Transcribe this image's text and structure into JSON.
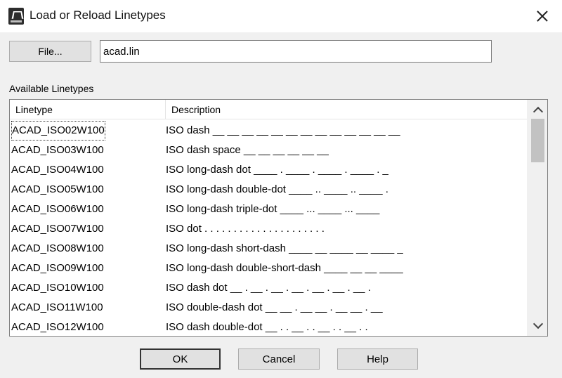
{
  "window": {
    "title": "Load or Reload Linetypes",
    "app_icon": "autocad-app-icon",
    "close_icon": "close-icon"
  },
  "file": {
    "button_label": "File...",
    "filename": "acad.lin"
  },
  "section_label": "Available Linetypes",
  "columns": {
    "linetype": "Linetype",
    "description": "Description"
  },
  "rows": [
    {
      "name": "ACAD_ISO02W100",
      "description": "ISO dash __ __ __ __ __ __ __ __ __ __ __ __ __"
    },
    {
      "name": "ACAD_ISO03W100",
      "description": "ISO dash space __    __    __    __    __    __"
    },
    {
      "name": "ACAD_ISO04W100",
      "description": "ISO long-dash dot ____ . ____ . ____ . ____ . _"
    },
    {
      "name": "ACAD_ISO05W100",
      "description": "ISO long-dash double-dot ____ .. ____ .. ____ ."
    },
    {
      "name": "ACAD_ISO06W100",
      "description": "ISO long-dash triple-dot ____ ... ____ ... ____"
    },
    {
      "name": "ACAD_ISO07W100",
      "description": "ISO dot . . . . . . . . . . . . . . . . . . . . ."
    },
    {
      "name": "ACAD_ISO08W100",
      "description": "ISO long-dash short-dash ____ __ ____ __ ____ _"
    },
    {
      "name": "ACAD_ISO09W100",
      "description": "ISO long-dash double-short-dash ____ __ __ ____"
    },
    {
      "name": "ACAD_ISO10W100",
      "description": "ISO dash dot __ . __ . __ . __ . __ . __ . __ ."
    },
    {
      "name": "ACAD_ISO11W100",
      "description": "ISO double-dash dot __ __ . __ __ . __ __ . __"
    },
    {
      "name": "ACAD_ISO12W100",
      "description": "ISO dash double-dot __ . . __ . . __ . . __ . ."
    }
  ],
  "focused_row": 0,
  "buttons": {
    "ok": "OK",
    "cancel": "Cancel",
    "help": "Help"
  },
  "scrollbar": {
    "up_icon": "chevron-up-icon",
    "down_icon": "chevron-down-icon"
  }
}
